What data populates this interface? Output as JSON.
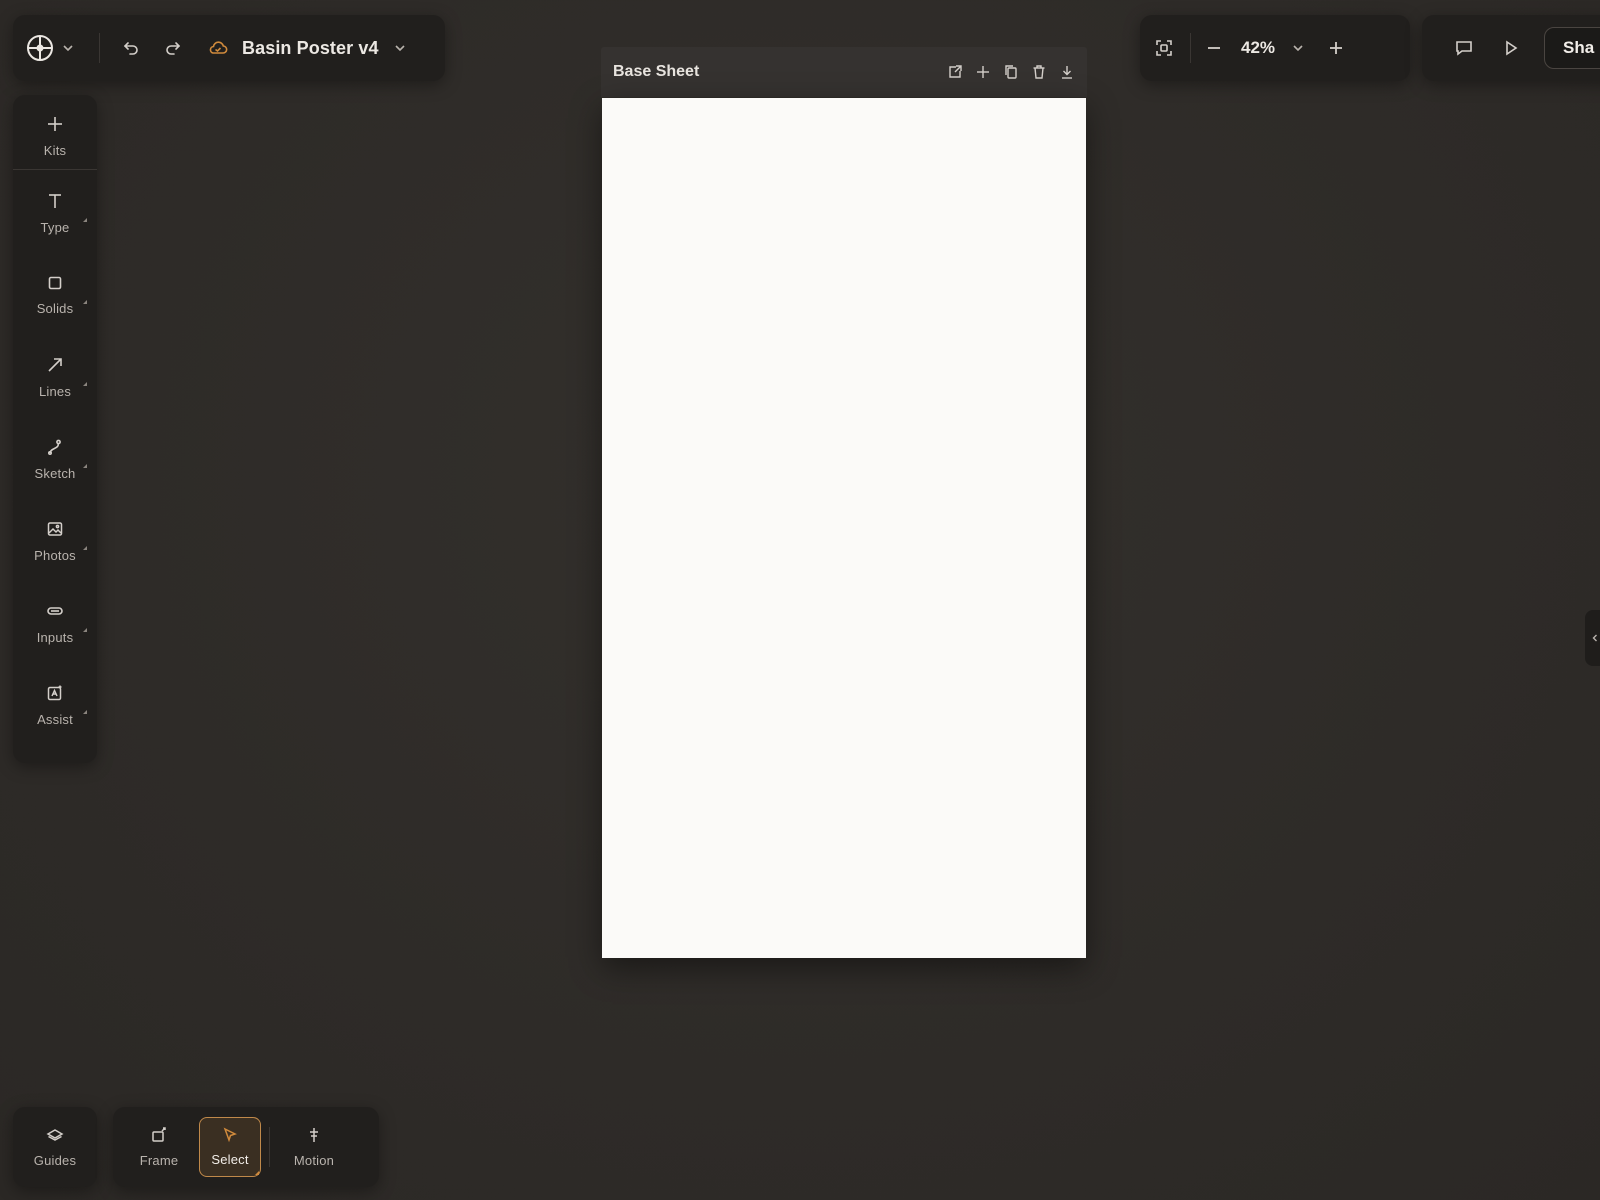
{
  "header": {
    "logo_icon": "crosshair-circle-icon",
    "doc_title": "Basin Poster v4",
    "sync_icon": "cloud-sync-icon",
    "accent_color": "#d08a3c"
  },
  "zoom": {
    "value": "42%"
  },
  "actions": {
    "share_label": "Sha"
  },
  "tools": {
    "kits": "Kits",
    "type": "Type",
    "solids": "Solids",
    "lines": "Lines",
    "sketch": "Sketch",
    "photos": "Photos",
    "inputs": "Inputs",
    "assist": "Assist"
  },
  "artboard": {
    "title": "Base Sheet",
    "background": "#fbfaf8"
  },
  "bottom": {
    "guides": "Guides",
    "frame": "Frame",
    "select": "Select",
    "motion": "Motion",
    "active_tool": "Select"
  }
}
